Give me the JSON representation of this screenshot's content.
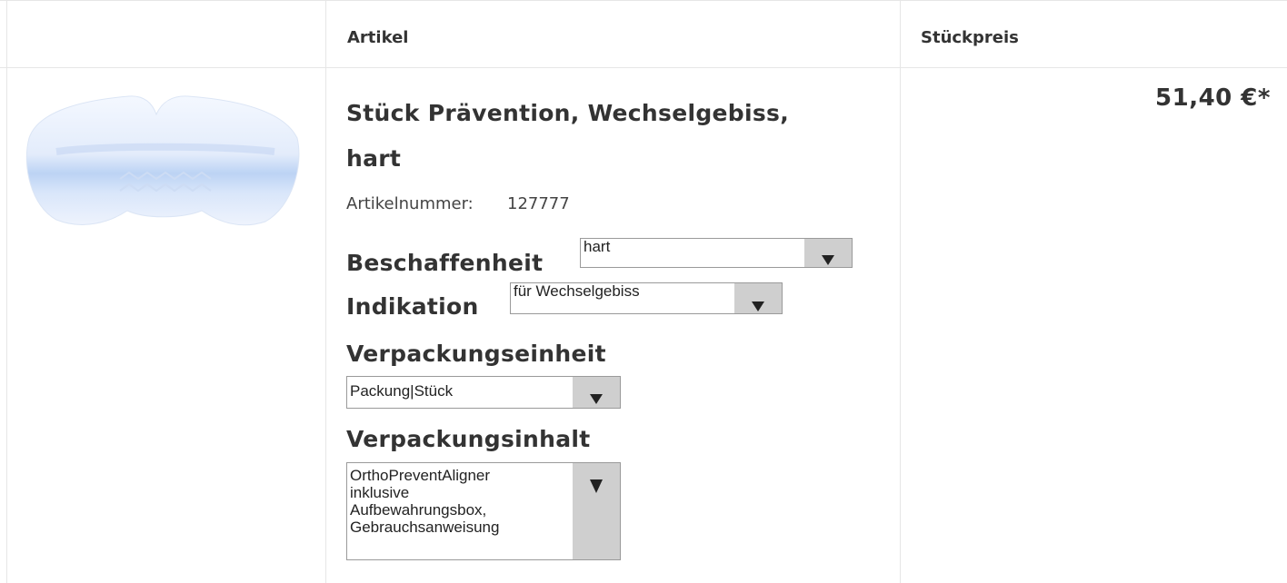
{
  "header": {
    "col_article": "Artikel",
    "col_unit_price": "Stückpreis"
  },
  "product": {
    "image_icon": "mouthguard-image",
    "title_line1": "Stück Prävention, Wechselgebiss,",
    "title_line2": "hart",
    "article_number_label": "Artikelnummer:",
    "article_number": "127777",
    "price": "51,40 €*"
  },
  "options": {
    "beschaffenheit": {
      "label": "Beschaffenheit",
      "value": "hart"
    },
    "indikation": {
      "label": "Indikation",
      "value": "für Wechselgebiss"
    },
    "verpackungseinheit": {
      "label": "Verpackungseinheit",
      "value": "Packung|Stück"
    },
    "verpackungsinhalt": {
      "label": "Verpackungsinhalt",
      "value_lines": [
        "OrthoPreventAligner",
        "inklusive",
        "Aufbewahrungsbox,",
        "Gebrauchsanweisung"
      ]
    }
  },
  "icons": {
    "dropdown": "triangle-down-icon"
  },
  "colors": {
    "border": "#e6e6e6",
    "select_button": "#cfcfcf",
    "text": "#333333"
  }
}
